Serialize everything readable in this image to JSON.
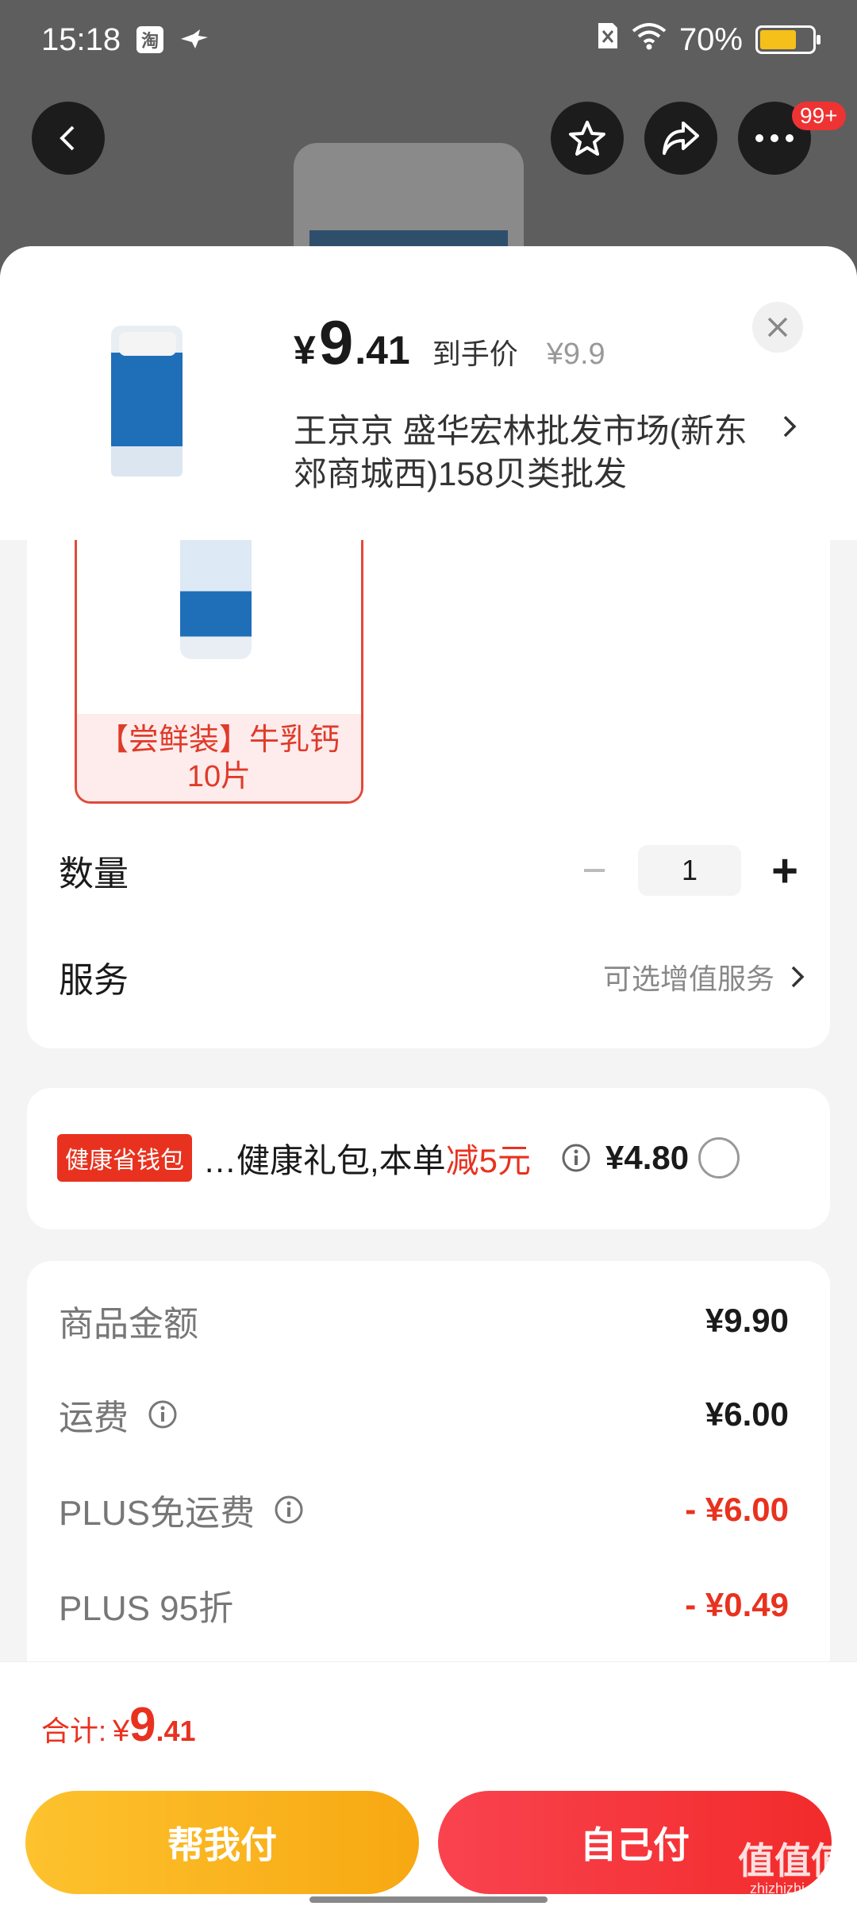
{
  "status_bar": {
    "time": "15:18",
    "app_chip": "淘",
    "battery": "70%",
    "battery_level": 0.7
  },
  "nav": {
    "badge": "99+"
  },
  "product": {
    "price_symbol": "¥",
    "price_int": "9",
    "price_dec": ".41",
    "price_label": "到手价",
    "original_price": "¥9.9",
    "shop_name": "王京京  盛华宏林批发市场(新东郊商城西)158贝类批发"
  },
  "variant": {
    "label": "【尝鲜装】牛乳钙10片"
  },
  "quantity": {
    "label": "数量",
    "minus": "−",
    "value": "1",
    "plus": "+"
  },
  "service": {
    "label": "服务",
    "value": "可选增值服务"
  },
  "promo": {
    "tag": "健康省钱包",
    "text": "…健康礼包,本单",
    "highlight": "减5元",
    "amount": "¥4.80"
  },
  "summary": [
    {
      "label": "商品金额",
      "value": "¥9.90",
      "red": false,
      "info": false
    },
    {
      "label": "运费",
      "value": "¥6.00",
      "red": false,
      "info": true
    },
    {
      "label": "PLUS免运费",
      "value": "- ¥6.00",
      "red": true,
      "info": true
    },
    {
      "label": "PLUS 95折",
      "value": "- ¥0.49",
      "red": true,
      "info": false
    }
  ],
  "total": {
    "label": "合计:",
    "symbol": "¥",
    "int": "9",
    "dec": ".41"
  },
  "buttons": {
    "help_pay": "帮我付",
    "self_pay": "自己付"
  },
  "watermark": {
    "main": "值值值",
    "sub": "zhizhizhi.com"
  },
  "colors": {
    "accent_red": "#e8321f",
    "help_pay": "#fdc22e",
    "self_pay": "#f9434f"
  }
}
